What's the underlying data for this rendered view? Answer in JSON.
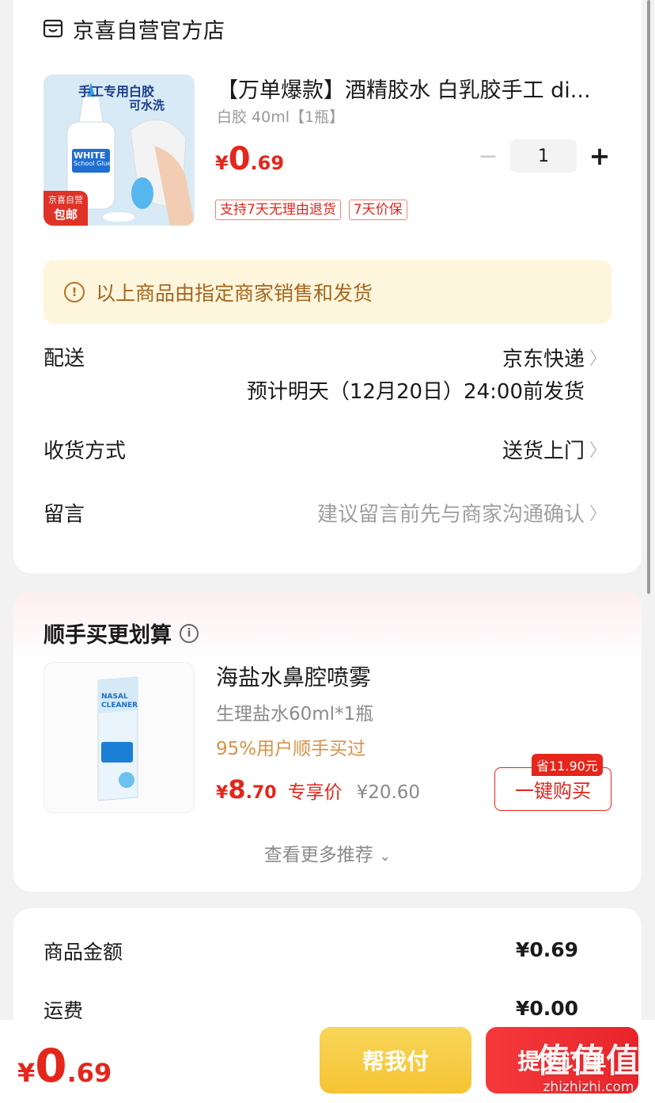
{
  "store": {
    "name": "京喜自营官方店",
    "icon": "store-icon"
  },
  "product": {
    "title": "【万单爆款】酒精胶水 白乳胶手工 di...",
    "spec": "白胶 40ml【1瓶】",
    "image_caption_line1": "手工专用白胶",
    "image_caption_line2": "可水洗",
    "image_label": "WHITE",
    "image_sublabel": "School Glue",
    "badge_top": "京喜自营",
    "badge_bottom": "包邮",
    "price_yen": "¥",
    "price_int": "0",
    "price_dec": ".69",
    "quantity": "1",
    "tags": [
      "支持7天无理由退货",
      "7天价保"
    ]
  },
  "notice": {
    "text": "以上商品由指定商家销售和发货",
    "icon": "info-icon"
  },
  "delivery": {
    "label": "配送",
    "carrier": "京东快递",
    "estimate": "预计明天（12月20日）24:00前发货"
  },
  "receive": {
    "label": "收货方式",
    "value": "送货上门"
  },
  "message": {
    "label": "留言",
    "placeholder": "建议留言前先与商家沟通确认"
  },
  "recommend": {
    "title": "顺手买更划算",
    "item": {
      "name": "海盐水鼻腔喷雾",
      "spec": "生理盐水60ml*1瓶",
      "buyers": "95%用户顺手买过",
      "price_yen": "¥",
      "price_int": "8",
      "price_dec": ".70",
      "exclusive": "专享价",
      "original": "¥20.60",
      "save": "省11.90元",
      "buy_label": "一键购买",
      "image_label": "NASAL CLEANER"
    },
    "more": "查看更多推荐"
  },
  "summary": {
    "goods_label": "商品金额",
    "goods_value": "¥0.69",
    "shipping_label": "运费",
    "shipping_value": "¥0.00"
  },
  "bottom": {
    "total_yen": "¥",
    "total_int": "0",
    "total_dec": ".69",
    "help_pay": "帮我付",
    "submit": "提交订单",
    "watermark": "值值值",
    "watermark_url": "zhizhizhi.com"
  },
  "colors": {
    "accent": "#e4261b",
    "notice_bg": "#fdf6dc",
    "help_pay": "#f5c433"
  }
}
